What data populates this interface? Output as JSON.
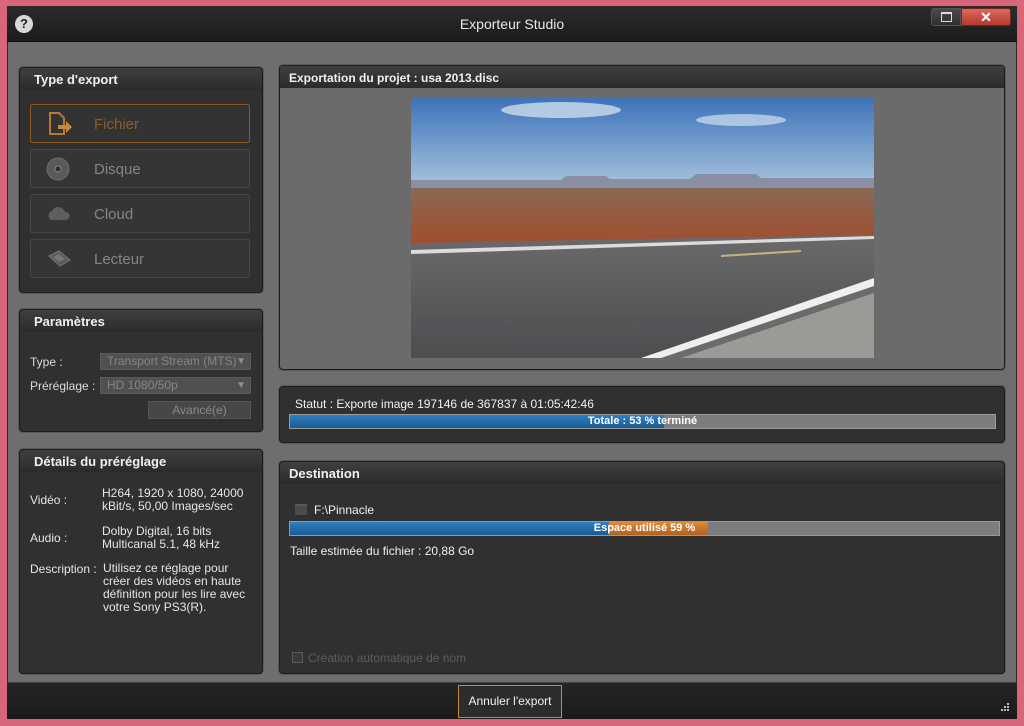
{
  "window": {
    "title": "Exporteur Studio"
  },
  "export_type": {
    "heading": "Type d'export",
    "options": [
      {
        "label": "Fichier",
        "icon": "file-export-icon",
        "active": true
      },
      {
        "label": "Disque",
        "icon": "disc-icon",
        "active": false
      },
      {
        "label": "Cloud",
        "icon": "cloud-icon",
        "active": false
      },
      {
        "label": "Lecteur",
        "icon": "device-icon",
        "active": false
      }
    ]
  },
  "params": {
    "heading": "Paramètres",
    "type_label": "Type :",
    "type_value": "Transport Stream (MTS)",
    "preset_label": "Préréglage :",
    "preset_value": "HD 1080/50p",
    "advanced_label": "Avancé(e)"
  },
  "preset_details": {
    "heading": "Détails du préréglage",
    "video_label": "Vidéo :",
    "video_value": "H264, 1920 x 1080, 24000 kBit/s, 50,00 Images/sec",
    "audio_label": "Audio :",
    "audio_value": "Dolby Digital, 16 bits Multicanal 5.1, 48 kHz",
    "description_label": "Description :",
    "description_value": "Utilisez ce réglage pour créer des vidéos en haute définition pour les lire avec votre Sony PS3(R)."
  },
  "preview": {
    "heading": "Exportation du projet : usa 2013.disc"
  },
  "status": {
    "text": "Statut : Exporte image 197146 de 367837 à 01:05:42:46",
    "progress_label": "Totale : 53 % terminé",
    "progress_percent": 53
  },
  "destination": {
    "heading": "Destination",
    "path": "F:\\Pinnacle",
    "space_label": "Espace utilisé 59 %",
    "space_used_percent": 59,
    "space_new_percent": 14,
    "estimated_size": "Taille estimée du fichier : 20,88 Go",
    "auto_name_label": "Création automatique de nom"
  },
  "footer": {
    "cancel_label": "Annuler l'export"
  },
  "colors": {
    "accent": "#c48a3a",
    "progress": "#1f6aa8",
    "window_bg": "#6e6e6e"
  }
}
